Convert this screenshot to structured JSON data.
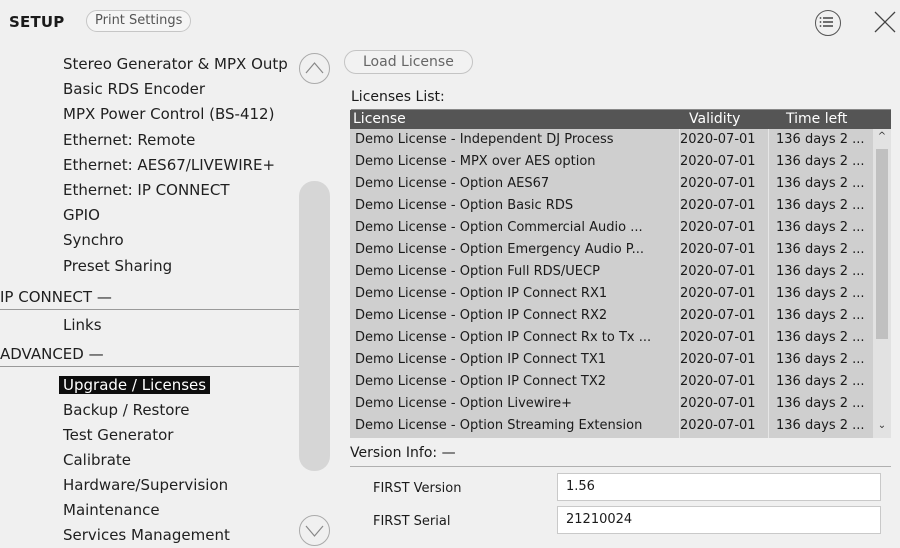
{
  "topbar": {
    "title": "SETUP",
    "print_label": "Print Settings"
  },
  "sidebar": {
    "items_top": [
      "Stereo Generator & MPX Outp",
      "Basic RDS Encoder",
      "MPX Power Control (BS-412)",
      "Ethernet: Remote",
      "Ethernet: AES67/LIVEWIRE+",
      "Ethernet: IP CONNECT",
      "GPIO",
      "Synchro",
      "Preset Sharing"
    ],
    "ipconnect_head": "IP CONNECT  —",
    "ipconnect_items": [
      "Links"
    ],
    "advanced_head": "ADVANCED  —",
    "advanced_items": [
      "Upgrade / Licenses",
      "Backup / Restore",
      "Test Generator",
      "Calibrate",
      "Hardware/Supervision",
      "Maintenance",
      "Services Management"
    ]
  },
  "main": {
    "load_license": "Load License",
    "licenses_list_label": "Licenses List:",
    "columns": [
      "License",
      "Validity",
      "Time left"
    ],
    "rows": [
      [
        "Demo License - Independent DJ Process",
        "2020-07-01",
        "136 days 2 ..."
      ],
      [
        "Demo License - MPX over AES option",
        "2020-07-01",
        "136 days 2 ..."
      ],
      [
        "Demo License - Option AES67",
        "2020-07-01",
        "136 days 2 ..."
      ],
      [
        "Demo License - Option Basic RDS",
        "2020-07-01",
        "136 days 2 ..."
      ],
      [
        "Demo License - Option Commercial Audio ...",
        "2020-07-01",
        "136 days 2 ..."
      ],
      [
        "Demo License - Option Emergency Audio P...",
        "2020-07-01",
        "136 days 2 ..."
      ],
      [
        "Demo License - Option Full RDS/UECP",
        "2020-07-01",
        "136 days 2 ..."
      ],
      [
        "Demo License - Option IP Connect RX1",
        "2020-07-01",
        "136 days 2 ..."
      ],
      [
        "Demo License - Option IP Connect RX2",
        "2020-07-01",
        "136 days 2 ..."
      ],
      [
        "Demo License - Option IP Connect Rx to Tx ...",
        "2020-07-01",
        "136 days 2 ..."
      ],
      [
        "Demo License - Option IP Connect TX1",
        "2020-07-01",
        "136 days 2 ..."
      ],
      [
        "Demo License - Option IP Connect TX2",
        "2020-07-01",
        "136 days 2 ..."
      ],
      [
        "Demo License - Option Livewire+",
        "2020-07-01",
        "136 days 2 ..."
      ],
      [
        "Demo License - Option Streaming Extension",
        "2020-07-01",
        "136 days 2 ..."
      ]
    ],
    "version_info_label": "Version Info:  —",
    "version_label": "FIRST Version",
    "version_value": "1.56",
    "serial_label": "FIRST Serial",
    "serial_value": "21210024"
  },
  "icons": {
    "menu": "list-menu-icon",
    "close": "close-icon",
    "scroll_up": "chevron-up-icon",
    "scroll_down": "chevron-down-icon"
  },
  "colors": {
    "selected_bg": "#0d0d0d",
    "table_header": "#555555",
    "table_body": "#cfcfcf"
  }
}
